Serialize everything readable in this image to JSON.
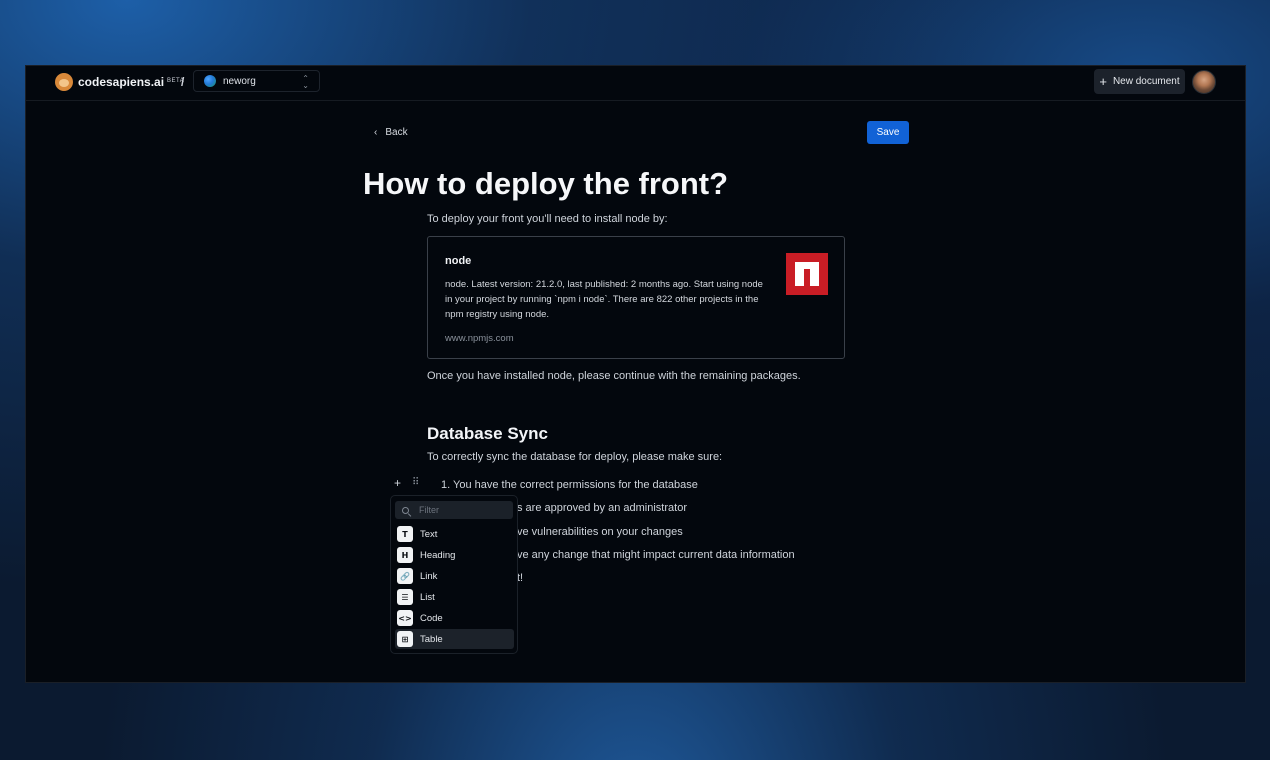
{
  "header": {
    "brand": "codesapiens.ai",
    "badge": "BETA",
    "separator": "/",
    "org": "neworg",
    "new_document": "New document",
    "new_document_icon": "plus-icon"
  },
  "toolbar": {
    "back": "Back",
    "save": "Save"
  },
  "doc": {
    "title": "How to deploy the front?",
    "intro": "To deploy your front you'll need to install node by:",
    "card": {
      "title": "node",
      "description": "node. Latest version: 21.2.0, last published: 2 months ago. Start using node in your project by running `npm i node`. There are 822 other projects in the npm registry using node.",
      "url": "www.npmjs.com"
    },
    "after_card": "Once you have installed node, please continue with the remaining packages.",
    "section_title": "Database Sync",
    "section_intro": "To correctly sync the database for deploy, please make sure:",
    "list": [
      "1.  You have the correct permissions for the database",
      "s are approved by an administrator",
      "ve vulnerabilities on your changes",
      "ve any change that might impact current data information",
      "t!"
    ]
  },
  "block_menu": {
    "add": "+",
    "drag": "⠿",
    "filter_placeholder": "Filter",
    "items": [
      {
        "label": "Text",
        "glyph": "T"
      },
      {
        "label": "Heading",
        "glyph": "H"
      },
      {
        "label": "Link",
        "glyph": "🔗"
      },
      {
        "label": "List",
        "glyph": "☰"
      },
      {
        "label": "Code",
        "glyph": "<>"
      },
      {
        "label": "Table",
        "glyph": "⊞"
      }
    ],
    "selected": "Table"
  },
  "colors": {
    "accent": "#1162d6",
    "npm_red": "#c91d25",
    "surface": "#03070d"
  }
}
